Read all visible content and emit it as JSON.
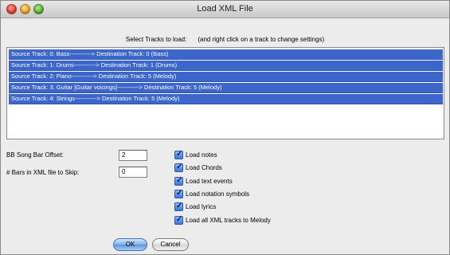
{
  "window": {
    "title": "Load XML File"
  },
  "instruction": {
    "main": "Select Tracks to  load:",
    "hint": "(and right click on a track to change settings)"
  },
  "tracks": [
    "Source Track:  0: Bass-----------> Destination Track: 0 (Bass)",
    "Source Track:  1: Drums-----------> Destination Track: 1 (Drums)",
    "Source Track:  2: Piano-----------> Destination Track: 5 (Melody)",
    "Source Track:  3: Guitar [Guitar voicings]-----------> Destination Track: 5 (Melody)",
    "Source Track:  4: Strings-----------> Destination Track: 5 (Melody)"
  ],
  "fields": {
    "song_bar_offset": {
      "label": "BB Song Bar Offset:",
      "value": "2"
    },
    "bars_to_skip": {
      "label": "# Bars in XML file to Skip:",
      "value": "0"
    }
  },
  "options": [
    {
      "label": "Load notes",
      "checked": true
    },
    {
      "label": "Load Chords",
      "checked": true
    },
    {
      "label": "Load text events",
      "checked": true
    },
    {
      "label": "Load notation symbols",
      "checked": true
    },
    {
      "label": "Load lyrics",
      "checked": true
    },
    {
      "label": "Load all XML tracks to Melody",
      "checked": true
    }
  ],
  "buttons": {
    "ok": "OK",
    "cancel": "Cancel"
  },
  "icons": {
    "checkmark": "checkmark-icon"
  },
  "colors": {
    "selection": "#3c66c9",
    "checkbox": "#3d78dc",
    "default_button": "#5a97e0"
  }
}
